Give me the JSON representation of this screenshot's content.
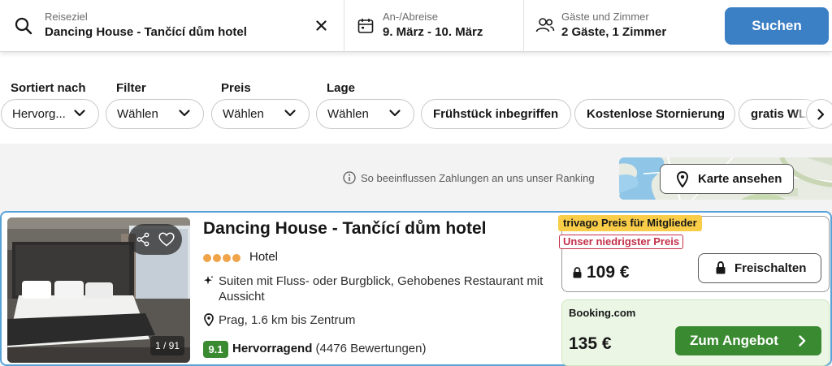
{
  "search": {
    "destination_label": "Reiseziel",
    "destination_value": "Dancing House - Tančící dům hotel",
    "dates_label": "An-/Abreise",
    "dates_value": "9. März - 10. März",
    "guests_label": "Gäste und Zimmer",
    "guests_value": "2 Gäste, 1 Zimmer",
    "submit_label": "Suchen",
    "accent_color": "#3b7fc4"
  },
  "filters": {
    "sort_label": "Sortiert nach",
    "sort_value": "Hervorg...",
    "filter_label": "Filter",
    "filter_value": "Wählen",
    "price_label": "Preis",
    "price_value": "Wählen",
    "location_label": "Lage",
    "location_value": "Wählen",
    "chips": [
      "Frühstück inbegriffen",
      "Kostenlose Stornierung",
      "gratis WL"
    ]
  },
  "info": {
    "ranking_note": "So beeinflussen Zahlungen an uns unser Ranking",
    "map_button": "Karte ansehen"
  },
  "hotel": {
    "name": "Dancing House - Tančící dům hotel",
    "star_count": 4,
    "type": "Hotel",
    "amenities": "Suiten mit Fluss- oder Burgblick, Gehobenes Restaurant mit Aussicht",
    "location": "Prag, 1.6 km bis Zentrum",
    "rating_score": "9.1",
    "rating_label": "Hervorragend",
    "review_count": "(4476 Bewertungen)",
    "photo_counter": "1 / 91",
    "rating_color": "#3a8a32"
  },
  "offers": {
    "member_tag": "trivago Preis für Mitglieder",
    "lowest_tag": "Unser niedrigster Preis",
    "member_price": "109 €",
    "unlock_button": "Freischalten",
    "provider": "Booking.com",
    "provider_price": "135 €",
    "deal_button": "Zum Angebot"
  }
}
